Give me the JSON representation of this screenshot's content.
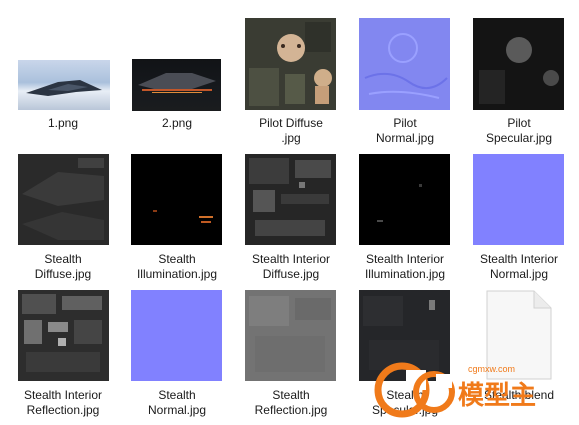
{
  "files": [
    {
      "name": "1.png"
    },
    {
      "name": "2.png"
    },
    {
      "name": "Pilot Diffuse\n.jpg"
    },
    {
      "name": "Pilot\nNormal.jpg"
    },
    {
      "name": "Pilot\nSpecular.jpg"
    },
    {
      "name": "Stealth\nDiffuse.jpg"
    },
    {
      "name": "Stealth\nIllumination.jpg"
    },
    {
      "name": "Stealth Interior\nDiffuse.jpg"
    },
    {
      "name": "Stealth Interior\nIllumination.jpg"
    },
    {
      "name": "Stealth Interior\nNormal.jpg"
    },
    {
      "name": "Stealth Interior\nReflection.jpg"
    },
    {
      "name": "Stealth\nNormal.jpg"
    },
    {
      "name": "Stealth\nReflection.jpg"
    },
    {
      "name": "Stealth\nSpecular.jpg"
    },
    {
      "name": "Stealth.blend"
    }
  ],
  "watermark": {
    "text": "CG模型主",
    "url": "cgmxw.com"
  }
}
